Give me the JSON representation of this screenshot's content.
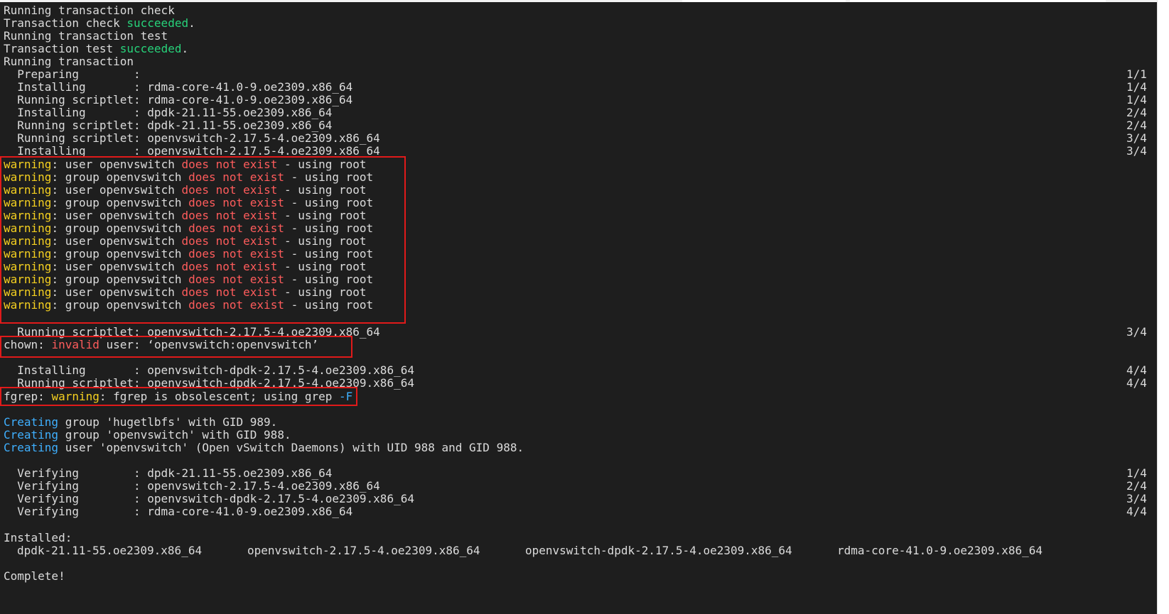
{
  "terminal": {
    "transaction": {
      "check": "Running transaction check",
      "check_result_prefix": "Transaction check ",
      "check_result": "succeeded",
      "check_result_suffix": ".",
      "test": "Running transaction test",
      "test_result_prefix": "Transaction test ",
      "test_result": "succeeded",
      "test_result_suffix": ".",
      "running": "Running transaction"
    },
    "steps_top": [
      {
        "action": "  Preparing        :",
        "pkg": "",
        "count": "1/1"
      },
      {
        "action": "  Installing       :",
        "pkg": " rdma-core-41.0-9.oe2309.x86_64",
        "count": "1/4"
      },
      {
        "action": "  Running scriptlet:",
        "pkg": " rdma-core-41.0-9.oe2309.x86_64",
        "count": "1/4"
      },
      {
        "action": "  Installing       :",
        "pkg": " dpdk-21.11-55.oe2309.x86_64",
        "count": "2/4"
      },
      {
        "action": "  Running scriptlet:",
        "pkg": " dpdk-21.11-55.oe2309.x86_64",
        "count": "2/4"
      },
      {
        "action": "  Running scriptlet:",
        "pkg": " openvswitch-2.17.5-4.oe2309.x86_64",
        "count": "3/4"
      },
      {
        "action": "  Installing       :",
        "pkg": " openvswitch-2.17.5-4.oe2309.x86_64",
        "count": "3/4"
      }
    ],
    "warnings": [
      {
        "tag": "warning",
        "subject": ": user openvswitch ",
        "err": "does not exist",
        "tail": " - using root"
      },
      {
        "tag": "warning",
        "subject": ": group openvswitch ",
        "err": "does not exist",
        "tail": " - using root"
      },
      {
        "tag": "warning",
        "subject": ": user openvswitch ",
        "err": "does not exist",
        "tail": " - using root"
      },
      {
        "tag": "warning",
        "subject": ": group openvswitch ",
        "err": "does not exist",
        "tail": " - using root"
      },
      {
        "tag": "warning",
        "subject": ": user openvswitch ",
        "err": "does not exist",
        "tail": " - using root"
      },
      {
        "tag": "warning",
        "subject": ": group openvswitch ",
        "err": "does not exist",
        "tail": " - using root"
      },
      {
        "tag": "warning",
        "subject": ": user openvswitch ",
        "err": "does not exist",
        "tail": " - using root"
      },
      {
        "tag": "warning",
        "subject": ": group openvswitch ",
        "err": "does not exist",
        "tail": " - using root"
      },
      {
        "tag": "warning",
        "subject": ": user openvswitch ",
        "err": "does not exist",
        "tail": " - using root"
      },
      {
        "tag": "warning",
        "subject": ": group openvswitch ",
        "err": "does not exist",
        "tail": " - using root"
      },
      {
        "tag": "warning",
        "subject": ": user openvswitch ",
        "err": "does not exist",
        "tail": " - using root"
      },
      {
        "tag": "warning",
        "subject": ": group openvswitch ",
        "err": "does not exist",
        "tail": " - using root"
      }
    ],
    "scriptlet_ovs": {
      "action": "  Running scriptlet:",
      "pkg": " openvswitch-2.17.5-4.oe2309.x86_64",
      "count": "3/4"
    },
    "chown": {
      "prefix": "chown: ",
      "err": "invalid",
      "tail": " user: ‘openvswitch:openvswitch’"
    },
    "steps_dpdk": [
      {
        "action": "  Installing       :",
        "pkg": " openvswitch-dpdk-2.17.5-4.oe2309.x86_64",
        "count": "4/4"
      },
      {
        "action": "  Running scriptlet:",
        "pkg": " openvswitch-dpdk-2.17.5-4.oe2309.x86_64",
        "count": "4/4"
      }
    ],
    "fgrep": {
      "prefix": "fgrep: ",
      "tag": "warning",
      "mid": ": fgrep is obsolescent; using grep ",
      "flag": "-F"
    },
    "creating": [
      {
        "verb": "Creating",
        "rest": " group 'hugetlbfs' with GID 989."
      },
      {
        "verb": "Creating",
        "rest": " group 'openvswitch' with GID 988."
      },
      {
        "verb": "Creating",
        "rest": " user 'openvswitch' (Open vSwitch Daemons) with UID 988 and GID 988."
      }
    ],
    "verifying": [
      {
        "action": "  Verifying        :",
        "pkg": " dpdk-21.11-55.oe2309.x86_64",
        "count": "1/4"
      },
      {
        "action": "  Verifying        :",
        "pkg": " openvswitch-2.17.5-4.oe2309.x86_64",
        "count": "2/4"
      },
      {
        "action": "  Verifying        :",
        "pkg": " openvswitch-dpdk-2.17.5-4.oe2309.x86_64",
        "count": "3/4"
      },
      {
        "action": "  Verifying        :",
        "pkg": " rdma-core-41.0-9.oe2309.x86_64",
        "count": "4/4"
      }
    ],
    "installed_label": "Installed:",
    "installed_packages": [
      "dpdk-21.11-55.oe2309.x86_64",
      "openvswitch-2.17.5-4.oe2309.x86_64",
      "openvswitch-dpdk-2.17.5-4.oe2309.x86_64",
      "rdma-core-41.0-9.oe2309.x86_64"
    ],
    "complete": "Complete!"
  },
  "colors": {
    "background": "#1e1e1e",
    "text": "#dcdcdc",
    "success": "#27d27a",
    "warning": "#f5d020",
    "error": "#ff5c5c",
    "info": "#3fb0ff",
    "highlight_box": "#e01a1a"
  }
}
